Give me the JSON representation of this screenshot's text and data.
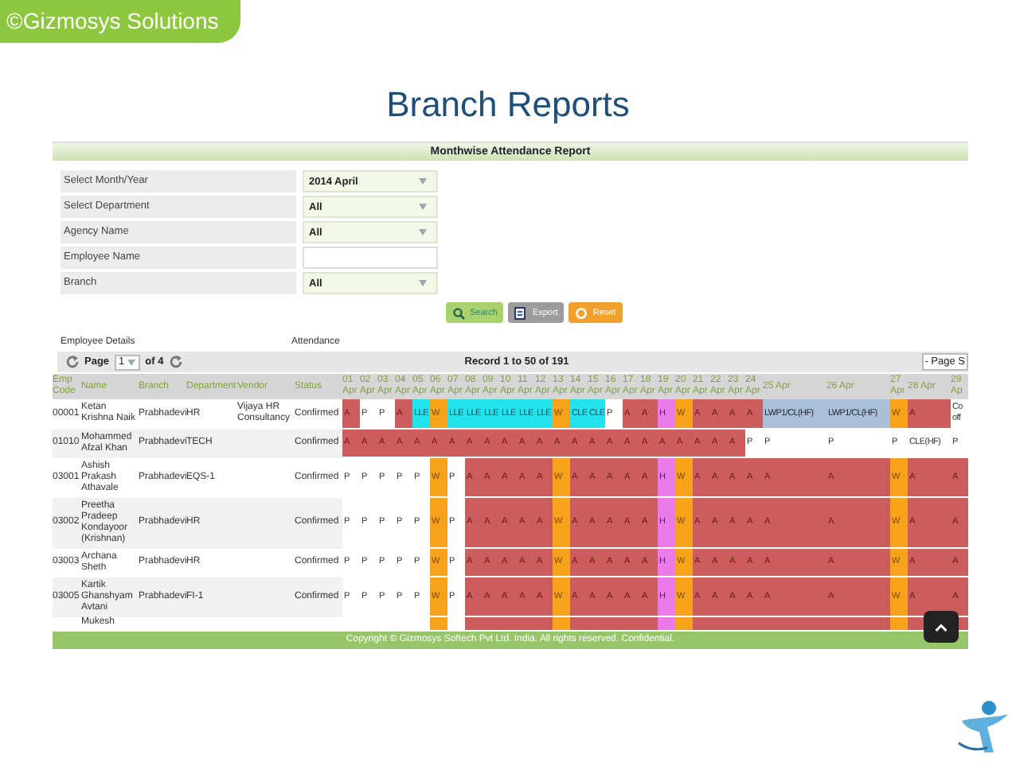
{
  "slide": {
    "brand": "©Gizmosys Solutions",
    "title": "Branch Reports"
  },
  "report": {
    "title": "Monthwise Attendance Report",
    "filters": [
      {
        "label": "Select Month/Year",
        "kind": "select",
        "value": "2014 April"
      },
      {
        "label": "Select Department",
        "kind": "select",
        "value": "All"
      },
      {
        "label": "Agency Name",
        "kind": "select",
        "value": "All"
      },
      {
        "label": "Employee Name",
        "kind": "text"
      },
      {
        "label": "Branch",
        "kind": "select",
        "value": "All"
      }
    ],
    "buttons": [
      {
        "label": "Search",
        "kind": "search"
      },
      {
        "label": "Export",
        "kind": "export"
      },
      {
        "label": "Reset",
        "kind": "reset"
      }
    ],
    "sections": [
      "Employee Details",
      "Attendance"
    ],
    "pager": {
      "page_label": "Page",
      "page": "1",
      "of": "of 4",
      "records": "Record 1 to 50 of 191",
      "page_size": "- Page S"
    },
    "columns": [
      "Emp Code",
      "Name",
      "Branch",
      "Department",
      "Vendor",
      "Status"
    ],
    "days": [
      "01 Apr",
      "02 Apr",
      "03 Apr",
      "04 Apr",
      "05 Apr",
      "06 Apr",
      "07 Apr",
      "08 Apr",
      "09 Apr",
      "10 Apr",
      "11 Apr",
      "12 Apr",
      "13 Apr",
      "14 Apr",
      "15 Apr",
      "16 Apr",
      "17 Apr",
      "18 Apr",
      "19 Apr",
      "20 Apr",
      "21 Apr",
      "22 Apr",
      "23 Apr",
      "24 Apr",
      "25 Apr",
      "26 Apr",
      "27 Apr",
      "28 Apr",
      "29 Ap"
    ],
    "rows": [
      {
        "code": "00001",
        "name": "Ketan Krishna Naik",
        "branch": "Prabhadevi",
        "department": "HR",
        "vendor": "Vijaya HR Consultancy",
        "status": "Confirmed",
        "cells": [
          {
            "text": "A",
            "kind": "absent"
          },
          {
            "text": "P",
            "kind": "present"
          },
          {
            "text": "P",
            "kind": "present"
          },
          {
            "text": "A",
            "kind": "absent"
          },
          {
            "text": "LLE",
            "kind": "leave"
          },
          {
            "text": "W",
            "kind": "weekoff"
          },
          {
            "text": "LLE",
            "kind": "leave"
          },
          {
            "text": "LLE",
            "kind": "leave"
          },
          {
            "text": "LLE",
            "kind": "leave"
          },
          {
            "text": "LLE",
            "kind": "leave"
          },
          {
            "text": "LLE",
            "kind": "leave"
          },
          {
            "text": "LLE",
            "kind": "leave"
          },
          {
            "text": "W",
            "kind": "weekoff"
          },
          {
            "text": "CLE",
            "kind": "leave"
          },
          {
            "text": "CLE",
            "kind": "leave"
          },
          {
            "text": "P",
            "kind": "present"
          },
          {
            "text": "A",
            "kind": "absent"
          },
          {
            "text": "A",
            "kind": "absent"
          },
          {
            "text": "H",
            "kind": "holiday"
          },
          {
            "text": "W",
            "kind": "weekoff"
          },
          {
            "text": "A",
            "kind": "absent"
          },
          {
            "text": "A",
            "kind": "absent"
          },
          {
            "text": "A",
            "kind": "absent"
          },
          {
            "text": "A",
            "kind": "absent"
          },
          {
            "text": "LWP1/CL(HF)",
            "kind": "lwp"
          },
          {
            "text": "LWP1/CL(HF)",
            "kind": "lwp"
          },
          {
            "text": "W",
            "kind": "weekoff"
          },
          {
            "text": "A",
            "kind": "absent"
          },
          {
            "text": "Co off",
            "kind": "other"
          }
        ]
      },
      {
        "code": "01010",
        "name": "Mohammed Afzal Khan",
        "branch": "Prabhadevi",
        "department": "TECH",
        "status": "Confirmed",
        "cells": [
          {
            "text": "A",
            "kind": "absent"
          },
          {
            "text": "A",
            "kind": "absent"
          },
          {
            "text": "A",
            "kind": "absent"
          },
          {
            "text": "A",
            "kind": "absent"
          },
          {
            "text": "A",
            "kind": "absent"
          },
          {
            "text": "A",
            "kind": "absent"
          },
          {
            "text": "A",
            "kind": "absent"
          },
          {
            "text": "A",
            "kind": "absent"
          },
          {
            "text": "A",
            "kind": "absent"
          },
          {
            "text": "A",
            "kind": "absent"
          },
          {
            "text": "A",
            "kind": "absent"
          },
          {
            "text": "A",
            "kind": "absent"
          },
          {
            "text": "A",
            "kind": "absent"
          },
          {
            "text": "A",
            "kind": "absent"
          },
          {
            "text": "A",
            "kind": "absent"
          },
          {
            "text": "A",
            "kind": "absent"
          },
          {
            "text": "A",
            "kind": "absent"
          },
          {
            "text": "A",
            "kind": "absent"
          },
          {
            "text": "A",
            "kind": "absent"
          },
          {
            "text": "A",
            "kind": "absent"
          },
          {
            "text": "A",
            "kind": "absent"
          },
          {
            "text": "A",
            "kind": "absent"
          },
          {
            "text": "A",
            "kind": "absent"
          },
          {
            "text": "P",
            "kind": "present"
          },
          {
            "text": "P",
            "kind": "present"
          },
          {
            "text": "P",
            "kind": "present"
          },
          {
            "text": "P",
            "kind": "present"
          },
          {
            "text": "CLE(HF)",
            "kind": "other"
          },
          {
            "text": "P",
            "kind": "present"
          }
        ]
      },
      {
        "code": "03001",
        "name": "Ashish Prakash Athavale",
        "branch": "Prabhadevi",
        "department": "EQS-1",
        "status": "Confirmed",
        "cells": [
          {
            "text": "P",
            "kind": "present"
          },
          {
            "text": "P",
            "kind": "present"
          },
          {
            "text": "P",
            "kind": "present"
          },
          {
            "text": "P",
            "kind": "present"
          },
          {
            "text": "P",
            "kind": "present"
          },
          {
            "text": "W",
            "kind": "weekoff"
          },
          {
            "text": "P",
            "kind": "present"
          },
          {
            "text": "A",
            "kind": "absent"
          },
          {
            "text": "A",
            "kind": "absent"
          },
          {
            "text": "A",
            "kind": "absent"
          },
          {
            "text": "A",
            "kind": "absent"
          },
          {
            "text": "A",
            "kind": "absent"
          },
          {
            "text": "W",
            "kind": "weekoff"
          },
          {
            "text": "A",
            "kind": "absent"
          },
          {
            "text": "A",
            "kind": "absent"
          },
          {
            "text": "A",
            "kind": "absent"
          },
          {
            "text": "A",
            "kind": "absent"
          },
          {
            "text": "A",
            "kind": "absent"
          },
          {
            "text": "H",
            "kind": "holiday"
          },
          {
            "text": "W",
            "kind": "weekoff"
          },
          {
            "text": "A",
            "kind": "absent"
          },
          {
            "text": "A",
            "kind": "absent"
          },
          {
            "text": "A",
            "kind": "absent"
          },
          {
            "text": "A",
            "kind": "absent"
          },
          {
            "text": "A",
            "kind": "absent"
          },
          {
            "text": "A",
            "kind": "absent"
          },
          {
            "text": "W",
            "kind": "weekoff"
          },
          {
            "text": "A",
            "kind": "absent"
          },
          {
            "text": "A",
            "kind": "absent"
          }
        ]
      },
      {
        "code": "03002",
        "name": "Preetha Pradeep Kondayoor (Krishnan)",
        "branch": "Prabhadevi",
        "department": "HR",
        "status": "Confirmed",
        "cells": [
          {
            "text": "P",
            "kind": "present"
          },
          {
            "text": "P",
            "kind": "present"
          },
          {
            "text": "P",
            "kind": "present"
          },
          {
            "text": "P",
            "kind": "present"
          },
          {
            "text": "P",
            "kind": "present"
          },
          {
            "text": "W",
            "kind": "weekoff"
          },
          {
            "text": "P",
            "kind": "present"
          },
          {
            "text": "A",
            "kind": "absent"
          },
          {
            "text": "A",
            "kind": "absent"
          },
          {
            "text": "A",
            "kind": "absent"
          },
          {
            "text": "A",
            "kind": "absent"
          },
          {
            "text": "A",
            "kind": "absent"
          },
          {
            "text": "W",
            "kind": "weekoff"
          },
          {
            "text": "A",
            "kind": "absent"
          },
          {
            "text": "A",
            "kind": "absent"
          },
          {
            "text": "A",
            "kind": "absent"
          },
          {
            "text": "A",
            "kind": "absent"
          },
          {
            "text": "A",
            "kind": "absent"
          },
          {
            "text": "H",
            "kind": "holiday"
          },
          {
            "text": "W",
            "kind": "weekoff"
          },
          {
            "text": "A",
            "kind": "absent"
          },
          {
            "text": "A",
            "kind": "absent"
          },
          {
            "text": "A",
            "kind": "absent"
          },
          {
            "text": "A",
            "kind": "absent"
          },
          {
            "text": "A",
            "kind": "absent"
          },
          {
            "text": "A",
            "kind": "absent"
          },
          {
            "text": "W",
            "kind": "weekoff"
          },
          {
            "text": "A",
            "kind": "absent"
          },
          {
            "text": "A",
            "kind": "absent"
          }
        ]
      },
      {
        "code": "03003",
        "name": "Archana Sheth",
        "branch": "Prabhadevi",
        "department": "HR",
        "status": "Confirmed",
        "cells": [
          {
            "text": "P",
            "kind": "present"
          },
          {
            "text": "P",
            "kind": "present"
          },
          {
            "text": "P",
            "kind": "present"
          },
          {
            "text": "P",
            "kind": "present"
          },
          {
            "text": "P",
            "kind": "present"
          },
          {
            "text": "W",
            "kind": "weekoff"
          },
          {
            "text": "P",
            "kind": "present"
          },
          {
            "text": "A",
            "kind": "absent"
          },
          {
            "text": "A",
            "kind": "absent"
          },
          {
            "text": "A",
            "kind": "absent"
          },
          {
            "text": "A",
            "kind": "absent"
          },
          {
            "text": "A",
            "kind": "absent"
          },
          {
            "text": "W",
            "kind": "weekoff"
          },
          {
            "text": "A",
            "kind": "absent"
          },
          {
            "text": "A",
            "kind": "absent"
          },
          {
            "text": "A",
            "kind": "absent"
          },
          {
            "text": "A",
            "kind": "absent"
          },
          {
            "text": "A",
            "kind": "absent"
          },
          {
            "text": "H",
            "kind": "holiday"
          },
          {
            "text": "W",
            "kind": "weekoff"
          },
          {
            "text": "A",
            "kind": "absent"
          },
          {
            "text": "A",
            "kind": "absent"
          },
          {
            "text": "A",
            "kind": "absent"
          },
          {
            "text": "A",
            "kind": "absent"
          },
          {
            "text": "A",
            "kind": "absent"
          },
          {
            "text": "A",
            "kind": "absent"
          },
          {
            "text": "W",
            "kind": "weekoff"
          },
          {
            "text": "A",
            "kind": "absent"
          },
          {
            "text": "A",
            "kind": "absent"
          }
        ]
      },
      {
        "code": "03005",
        "name": "Kartik Ghanshyam Avtani",
        "branch": "Prabhadevi",
        "department": "FI-1",
        "status": "Confirmed",
        "cells": [
          {
            "text": "P",
            "kind": "present"
          },
          {
            "text": "P",
            "kind": "present"
          },
          {
            "text": "P",
            "kind": "present"
          },
          {
            "text": "P",
            "kind": "present"
          },
          {
            "text": "P",
            "kind": "present"
          },
          {
            "text": "W",
            "kind": "weekoff"
          },
          {
            "text": "P",
            "kind": "present"
          },
          {
            "text": "A",
            "kind": "absent"
          },
          {
            "text": "A",
            "kind": "absent"
          },
          {
            "text": "A",
            "kind": "absent"
          },
          {
            "text": "A",
            "kind": "absent"
          },
          {
            "text": "A",
            "kind": "absent"
          },
          {
            "text": "W",
            "kind": "weekoff"
          },
          {
            "text": "A",
            "kind": "absent"
          },
          {
            "text": "A",
            "kind": "absent"
          },
          {
            "text": "A",
            "kind": "absent"
          },
          {
            "text": "A",
            "kind": "absent"
          },
          {
            "text": "A",
            "kind": "absent"
          },
          {
            "text": "H",
            "kind": "holiday"
          },
          {
            "text": "W",
            "kind": "weekoff"
          },
          {
            "text": "A",
            "kind": "absent"
          },
          {
            "text": "A",
            "kind": "absent"
          },
          {
            "text": "A",
            "kind": "absent"
          },
          {
            "text": "A",
            "kind": "absent"
          },
          {
            "text": "A",
            "kind": "absent"
          },
          {
            "text": "A",
            "kind": "absent"
          },
          {
            "text": "W",
            "kind": "weekoff"
          },
          {
            "text": "A",
            "kind": "absent"
          },
          {
            "text": "A",
            "kind": "absent"
          }
        ]
      },
      {
        "name": "Mukesh",
        "cells": [
          {
            "kind": "present"
          },
          {
            "kind": "present"
          },
          {
            "kind": "present"
          },
          {
            "kind": "present"
          },
          {
            "kind": "present"
          },
          {
            "kind": "weekoff"
          },
          {
            "kind": "present"
          },
          {
            "kind": "absent"
          },
          {
            "kind": "absent"
          },
          {
            "kind": "absent"
          },
          {
            "kind": "absent"
          },
          {
            "kind": "absent"
          },
          {
            "kind": "weekoff"
          },
          {
            "kind": "absent"
          },
          {
            "kind": "absent"
          },
          {
            "kind": "absent"
          },
          {
            "kind": "absent"
          },
          {
            "kind": "absent"
          },
          {
            "kind": "holiday"
          },
          {
            "kind": "weekoff"
          },
          {
            "kind": "absent"
          },
          {
            "kind": "absent"
          },
          {
            "kind": "absent"
          },
          {
            "kind": "absent"
          },
          {
            "kind": "absent"
          },
          {
            "kind": "absent"
          },
          {
            "kind": "weekoff"
          },
          {
            "kind": "absent"
          },
          {
            "kind": "absent"
          }
        ]
      }
    ],
    "footer": "Copyright © Gizmosys Softech Pvt Ltd. India. All rights reserved. Confidential."
  }
}
